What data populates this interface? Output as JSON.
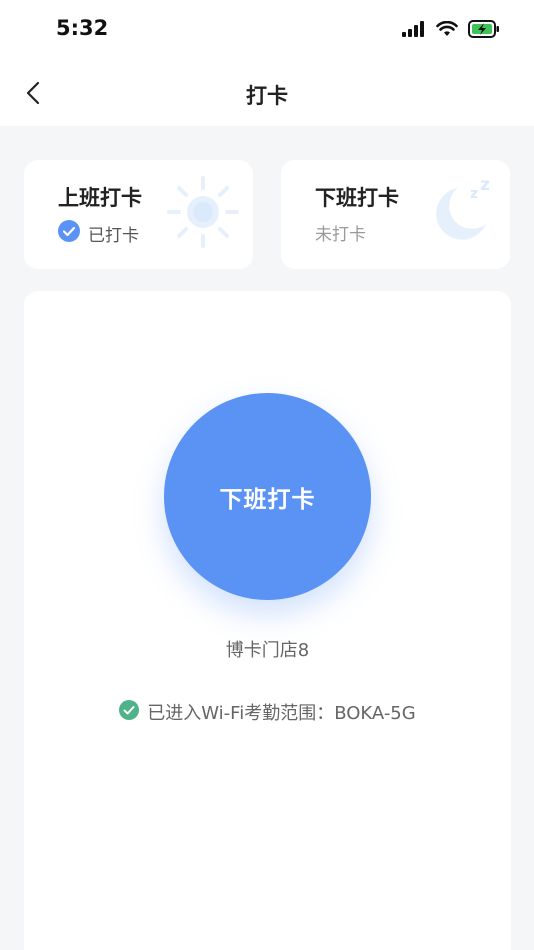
{
  "status_bar": {
    "time": "5:32"
  },
  "nav": {
    "title": "打卡"
  },
  "cards": {
    "clock_in": {
      "title": "上班打卡",
      "status": "已打卡"
    },
    "clock_out": {
      "title": "下班打卡",
      "status": "未打卡"
    }
  },
  "main": {
    "button_label": "下班打卡",
    "store_name": "博卡门店8",
    "wifi_status": "已进入Wi-Fi考勤范围：BOKA-5G"
  },
  "colors": {
    "accent": "#5b93f5",
    "success": "#4fb38a",
    "battery": "#3fc45a"
  }
}
